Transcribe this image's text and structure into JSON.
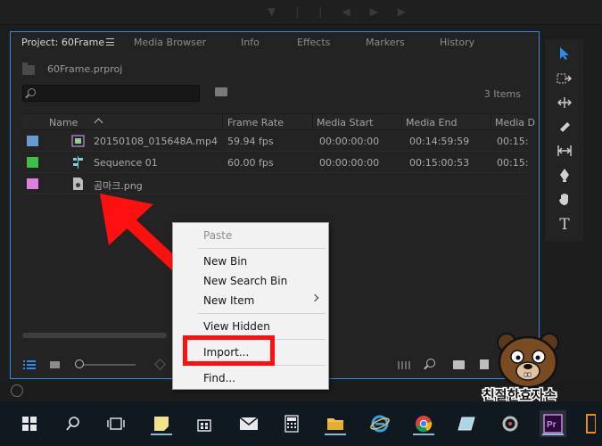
{
  "panel": {
    "tabs": [
      {
        "label": "Project: 60Frame",
        "active": true
      },
      {
        "label": "Media Browser"
      },
      {
        "label": "Info"
      },
      {
        "label": "Effects"
      },
      {
        "label": "Markers"
      },
      {
        "label": "History"
      }
    ],
    "project_file": "60Frame.prproj",
    "search": {
      "value": "",
      "placeholder": ""
    },
    "item_count": "3 Items",
    "columns": [
      "Name",
      "Frame Rate",
      "Media Start",
      "Media End",
      "Media D"
    ],
    "rows": [
      {
        "name": "20150108_015648A.mp4",
        "frame_rate": "59.94 fps",
        "media_start": "00:00:00:00",
        "media_end": "00:14:59:59",
        "media_duration": "00:15:",
        "label_color": "#6a9ad4",
        "icon": "video-clip-icon"
      },
      {
        "name": "Sequence 01",
        "frame_rate": "60.00 fps",
        "media_start": "00:00:00:00",
        "media_end": "00:15:00:53",
        "media_duration": "00:15:",
        "label_color": "#3fbf4a",
        "icon": "sequence-icon"
      },
      {
        "name": "곰마크.png",
        "frame_rate": "",
        "media_start": "",
        "media_end": "",
        "media_duration": "",
        "label_color": "#e07fe0",
        "icon": "image-file-icon"
      }
    ]
  },
  "context_menu": {
    "items": [
      {
        "label": "Paste",
        "disabled": true
      },
      {
        "label": "New Bin"
      },
      {
        "label": "New Search Bin"
      },
      {
        "label": "New Item",
        "submenu": true
      },
      {
        "label": "View Hidden"
      },
      {
        "label": "Import..."
      },
      {
        "label": "Find..."
      }
    ]
  },
  "watermark": {
    "text": "친절한효자손"
  },
  "colors": {
    "accent": "#2d8ceb",
    "annotation": "#ff1010"
  }
}
